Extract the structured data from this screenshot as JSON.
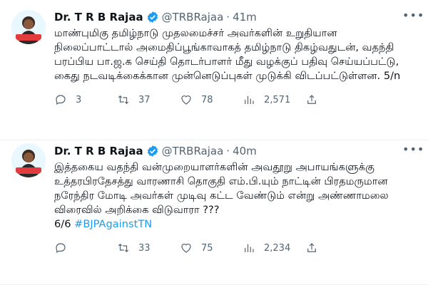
{
  "tweets": [
    {
      "author_name": "Dr. T R B Rajaa",
      "handle": "@TRBRajaa",
      "separator": "·",
      "time": "41m",
      "text": "மாண்புமிகு தமிழ்நாடு முதலமைச்சர் அவர்களின் உறுதியான நிலைப்பாட்டால் அமைதிப்பூங்காவாகத் தமிழ்நாடு திகழ்வதுடன், வதந்தி பரப்பிய பா.ஜ.க செய்தி தொடர்பாளர் மீது வழக்குப் பதிவு செய்யப்பட்டு, கைது நடவடிக்கைக்கான முன்னெடுப்புகள் முடுக்கி விடப்பட்டுள்ளன. 5/n",
      "hashtag": "",
      "replies": "3",
      "retweets": "37",
      "likes": "78",
      "views": "2,571"
    },
    {
      "author_name": "Dr. T R B Rajaa",
      "handle": "@TRBRajaa",
      "separator": "·",
      "time": "40m",
      "text": "இத்தகைய வதந்தி வன்முறையாளர்களின் அவதூறு அபாயங்களுக்கு உத்தரபிரதேசத்து வாரணாசி தொகுதி எம்.பி.யும் நாட்டின் பிரதமருமான நரேந்திர மோடி அவர்கள் முடிவு கட்ட வேண்டும் என்று அண்ணாமலை விரைவில் அறிக்கை விடுவாரா ???\n6/6 ",
      "hashtag": "#BJPAgainstTN",
      "replies": "",
      "retweets": "33",
      "likes": "75",
      "views": "2,234"
    }
  ],
  "colors": {
    "accent": "#1d9bf0",
    "muted": "#536471"
  },
  "icons": [
    "verified-badge-icon",
    "more-options-icon",
    "reply-icon",
    "retweet-icon",
    "like-icon",
    "views-icon",
    "share-icon"
  ]
}
